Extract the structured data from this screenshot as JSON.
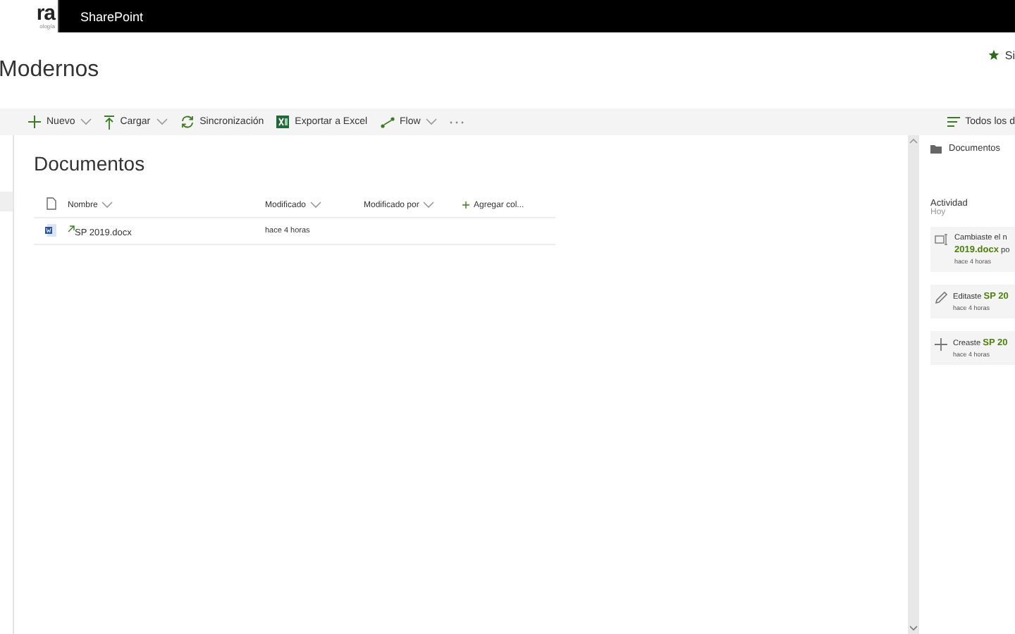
{
  "top_bar": {
    "logo_text": "ra",
    "logo_subtext": "ología",
    "app_name": "SharePoint"
  },
  "header": {
    "site_title": "Modernos",
    "follow_label": "Si"
  },
  "command_bar": {
    "items": [
      {
        "kind": "new",
        "label": "Nuevo",
        "has_menu": true
      },
      {
        "kind": "upload",
        "label": "Cargar",
        "has_menu": true
      },
      {
        "kind": "sync",
        "label": "Sincronización",
        "has_menu": false
      },
      {
        "kind": "excel",
        "label": "Exportar a Excel",
        "has_menu": false
      },
      {
        "kind": "flow",
        "label": "Flow",
        "has_menu": true
      },
      {
        "kind": "more",
        "has_menu": false
      }
    ],
    "view_label": "Todos los d"
  },
  "library": {
    "title": "Documentos",
    "columns": [
      {
        "kind": "sort",
        "label": "Nombre"
      },
      {
        "kind": "sort",
        "label": "Modificado"
      },
      {
        "kind": "sort",
        "label": "Modificado por"
      },
      {
        "kind": "add",
        "label": "Agregar col..."
      }
    ],
    "rows": [
      {
        "name": "SP 2019.docx",
        "modified": "hace 4 horas",
        "new": true
      }
    ]
  },
  "details_pane": {
    "title": "Documentos",
    "activity_heading": "Actividad",
    "day": "Hoy",
    "items": [
      {
        "kind": "rename",
        "text": "Cambiaste el n",
        "text_2": "**2019.docx** po",
        "time": "hace 4 horas"
      },
      {
        "kind": "edit",
        "text": "Editaste **SP 20**",
        "time": "hace 4 horas"
      },
      {
        "kind": "create",
        "text": "Creaste **SP 20**",
        "time": "hace 4 horas"
      }
    ]
  }
}
